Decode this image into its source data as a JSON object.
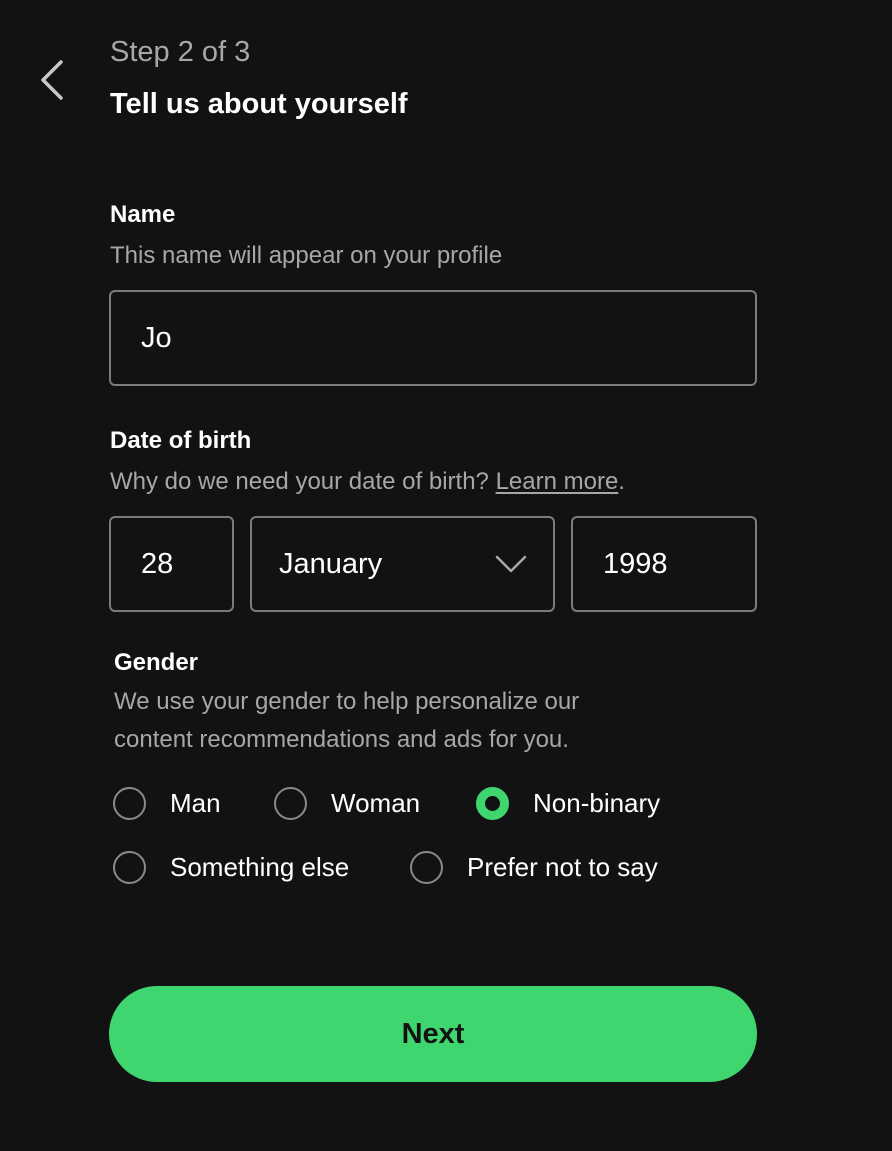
{
  "header": {
    "back_icon": "chevron-left-icon",
    "step": "Step 2 of 3",
    "title": "Tell us about yourself"
  },
  "name_field": {
    "label": "Name",
    "description": "This name will appear on your profile",
    "value": "Jo"
  },
  "dob_field": {
    "label": "Date of birth",
    "description": "Why do we need your date of birth?",
    "learn_more": "Learn more",
    "trailing": ".",
    "day": "28",
    "month": "January",
    "month_icon": "chevron-down-icon",
    "year": "1998"
  },
  "gender_field": {
    "label": "Gender",
    "description_line1": "We use your gender to help personalize our",
    "description_line2": "content recommendations and ads for you.",
    "options": [
      {
        "label": "Man",
        "selected": false
      },
      {
        "label": "Woman",
        "selected": false
      },
      {
        "label": "Non-binary",
        "selected": true
      },
      {
        "label": "Something else",
        "selected": false
      },
      {
        "label": "Prefer not to say",
        "selected": false
      }
    ]
  },
  "next_button": {
    "label": "Next"
  },
  "colors": {
    "background": "#121212",
    "accent": "#3fd670",
    "muted_text": "#a7a7a7",
    "border": "#7c7c7c"
  }
}
